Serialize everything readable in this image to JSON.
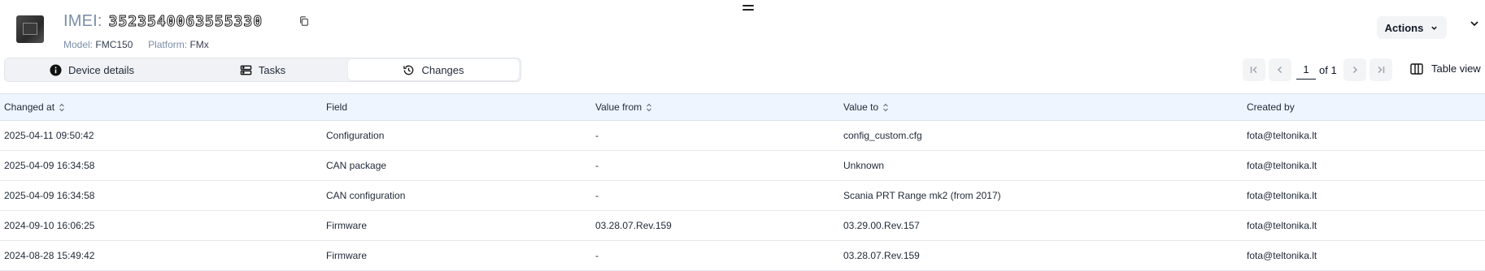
{
  "device": {
    "imei_label": "IMEI:",
    "imei_value": "3523540063555330",
    "model_label": "Model:",
    "model_value": "FMC150",
    "platform_label": "Platform:",
    "platform_value": "FMx"
  },
  "actions": {
    "label": "Actions"
  },
  "tabs": [
    {
      "label": "Device details",
      "icon": "info-icon",
      "active": false
    },
    {
      "label": "Tasks",
      "icon": "tasks-icon",
      "active": false
    },
    {
      "label": "Changes",
      "icon": "history-icon",
      "active": true
    }
  ],
  "pagination": {
    "current": "1",
    "of_text": "of 1"
  },
  "view_toggle": {
    "label": "Table view"
  },
  "table": {
    "columns": [
      {
        "label": "Changed at",
        "sortable": true
      },
      {
        "label": "Field",
        "sortable": false
      },
      {
        "label": "Value from",
        "sortable": true
      },
      {
        "label": "Value to",
        "sortable": true
      },
      {
        "label": "Created by",
        "sortable": false
      }
    ],
    "rows": [
      [
        "2025-04-11 09:50:42",
        "Configuration",
        "-",
        "config_custom.cfg",
        "fota@teltonika.lt"
      ],
      [
        "2025-04-09 16:34:58",
        "CAN package",
        "-",
        "Unknown",
        "fota@teltonika.lt"
      ],
      [
        "2025-04-09 16:34:58",
        "CAN configuration",
        "-",
        "Scania PRT Range mk2 (from 2017)",
        "fota@teltonika.lt"
      ],
      [
        "2024-09-10 16:06:25",
        "Firmware",
        "03.28.07.Rev.159",
        "03.29.00.Rev.157",
        "fota@teltonika.lt"
      ],
      [
        "2024-08-28 15:49:42",
        "Firmware",
        "-",
        "03.28.07.Rev.159",
        "fota@teltonika.lt"
      ]
    ]
  },
  "colors": {
    "header_bg": "#eef5fe",
    "label_muted": "#7b8ea8",
    "button_bg": "#f3f4f6"
  }
}
